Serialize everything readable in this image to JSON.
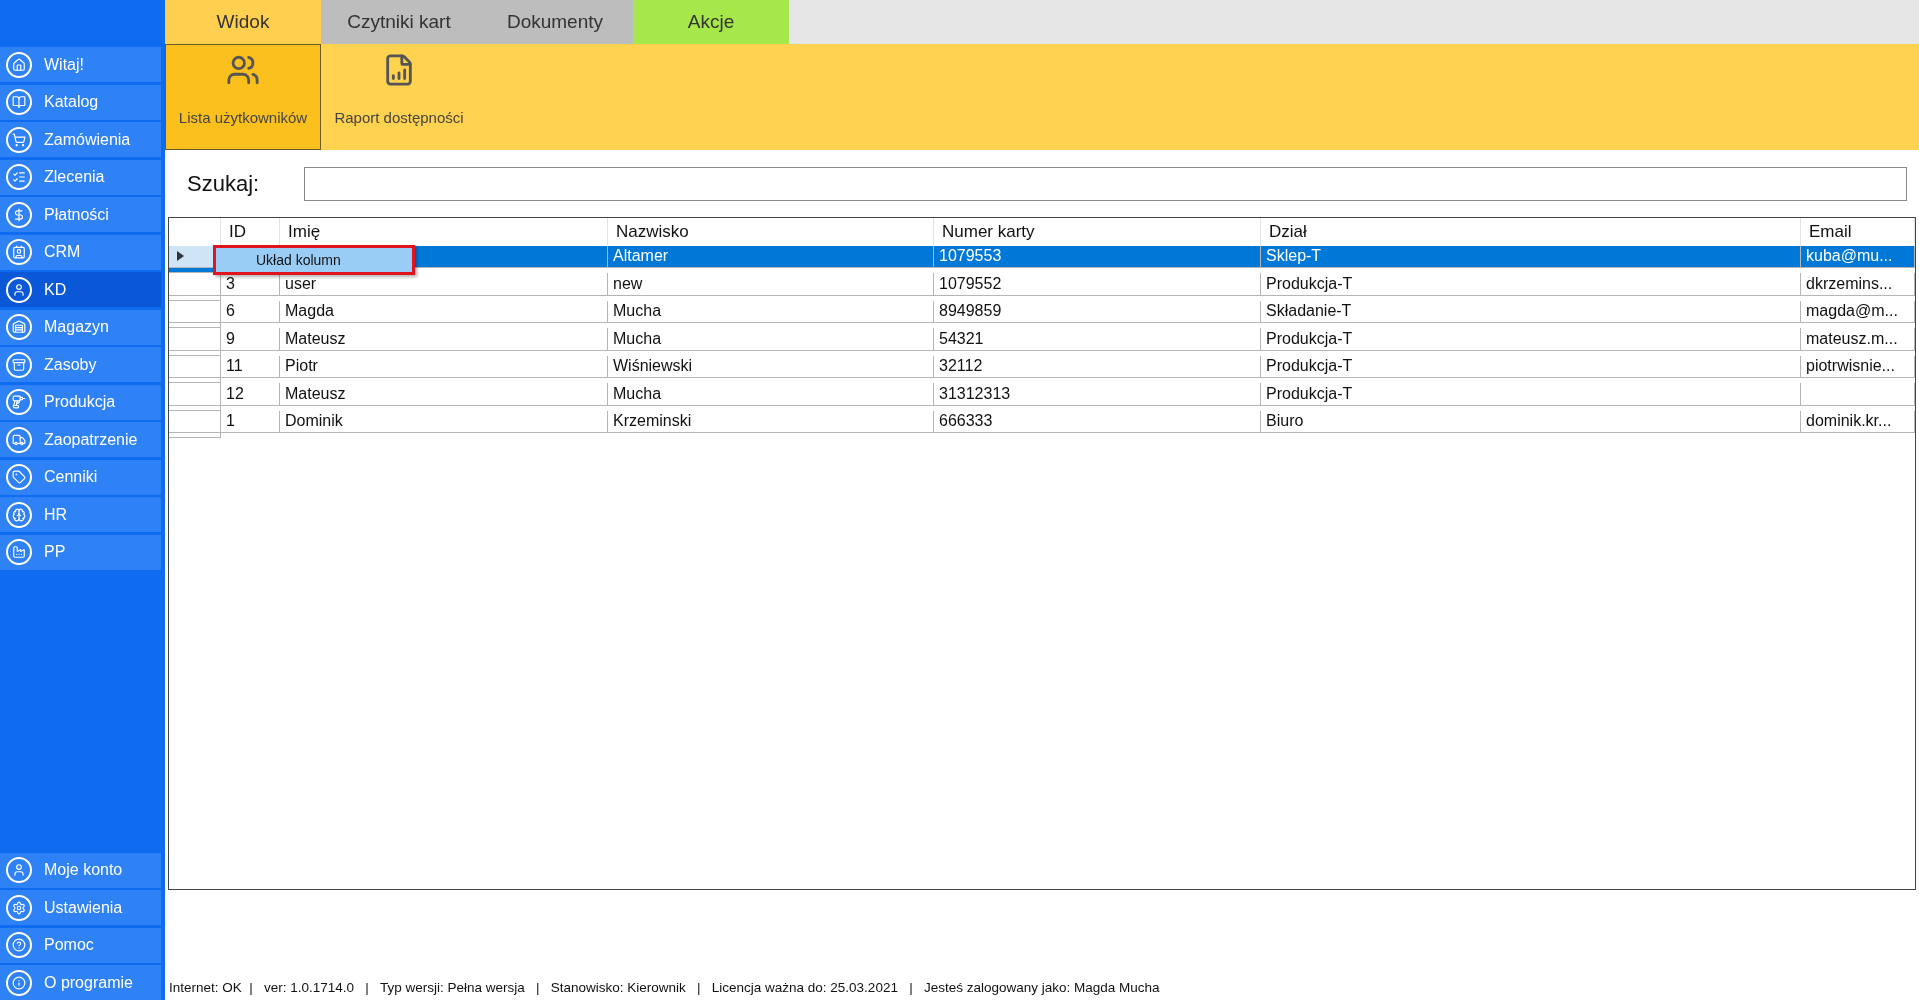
{
  "sidebar": {
    "items": [
      {
        "label": "Witaj!",
        "selected": false
      },
      {
        "label": "Katalog",
        "selected": false
      },
      {
        "label": "Zamówienia",
        "selected": false
      },
      {
        "label": "Zlecenia",
        "selected": false
      },
      {
        "label": "Płatności",
        "selected": false
      },
      {
        "label": "CRM",
        "selected": false
      },
      {
        "label": "KD",
        "selected": true
      },
      {
        "label": "Magazyn",
        "selected": false
      },
      {
        "label": "Zasoby",
        "selected": false
      },
      {
        "label": "Produkcja",
        "selected": false
      },
      {
        "label": "Zaopatrzenie",
        "selected": false
      },
      {
        "label": "Cenniki",
        "selected": false
      },
      {
        "label": "HR",
        "selected": false
      },
      {
        "label": "PP",
        "selected": false
      }
    ],
    "bottom_items": [
      {
        "label": "Moje konto"
      },
      {
        "label": "Ustawienia"
      },
      {
        "label": "Pomoc"
      },
      {
        "label": "O programie"
      }
    ]
  },
  "tabs": [
    {
      "label": "Widok",
      "color": "#ffd04f"
    },
    {
      "label": "Czytniki kart",
      "color": "#bdbdbd"
    },
    {
      "label": "Dokumenty",
      "color": "#bdbdbd"
    },
    {
      "label": "Akcje",
      "color": "#a6e84a"
    }
  ],
  "ribbon": {
    "buttons": [
      {
        "label": "Lista użytkowników",
        "selected": true
      },
      {
        "label": "Raport dostępności",
        "selected": false
      }
    ]
  },
  "search": {
    "label": "Szukaj:"
  },
  "table": {
    "columns": [
      "ID",
      "Imię",
      "Nazwisko",
      "Numer karty",
      "Dział",
      "Email"
    ],
    "rows": [
      {
        "nazwisko": "Altamer",
        "numer_karty": "1079553",
        "dzial": "Sklep-T",
        "email": "kuba@mu...",
        "selected": true
      },
      {
        "id": "3",
        "imie": "user",
        "nazwisko": "new",
        "numer_karty": "1079552",
        "dzial": "Produkcja-T",
        "email": "dkrzemins...",
        "selected": false
      },
      {
        "id": "6",
        "imie": "Magda",
        "nazwisko": "Mucha",
        "numer_karty": "8949859",
        "dzial": "Składanie-T",
        "email": "magda@m...",
        "selected": false
      },
      {
        "id": "9",
        "imie": "Mateusz",
        "nazwisko": "Mucha",
        "numer_karty": "54321",
        "dzial": "Produkcja-T",
        "email": "mateusz.m...",
        "selected": false
      },
      {
        "id": "11",
        "imie": "Piotr",
        "nazwisko": "Wiśniewski",
        "numer_karty": "32112",
        "dzial": "Produkcja-T",
        "email": "piotrwisnie...",
        "selected": false
      },
      {
        "id": "12",
        "imie": "Mateusz",
        "nazwisko": "Mucha",
        "numer_karty": "31312313",
        "dzial": "Produkcja-T",
        "selected": false
      },
      {
        "id": "1",
        "imie": "Dominik",
        "nazwisko": "Krzeminski",
        "numer_karty": "666333",
        "dzial": "Biuro",
        "email": "dominik.kr...",
        "selected": false
      }
    ]
  },
  "context_menu": {
    "items": [
      "Układ kolumn"
    ]
  },
  "status_bar": "Internet: OK  |   ver: 1.0.1714.0   |   Typ wersji: Pełna wersja   |   Stanowisko: Kierownik   |   Licencja ważna do: 25.03.2021   |   Jesteś zalogowany jako: Magda Mucha"
}
